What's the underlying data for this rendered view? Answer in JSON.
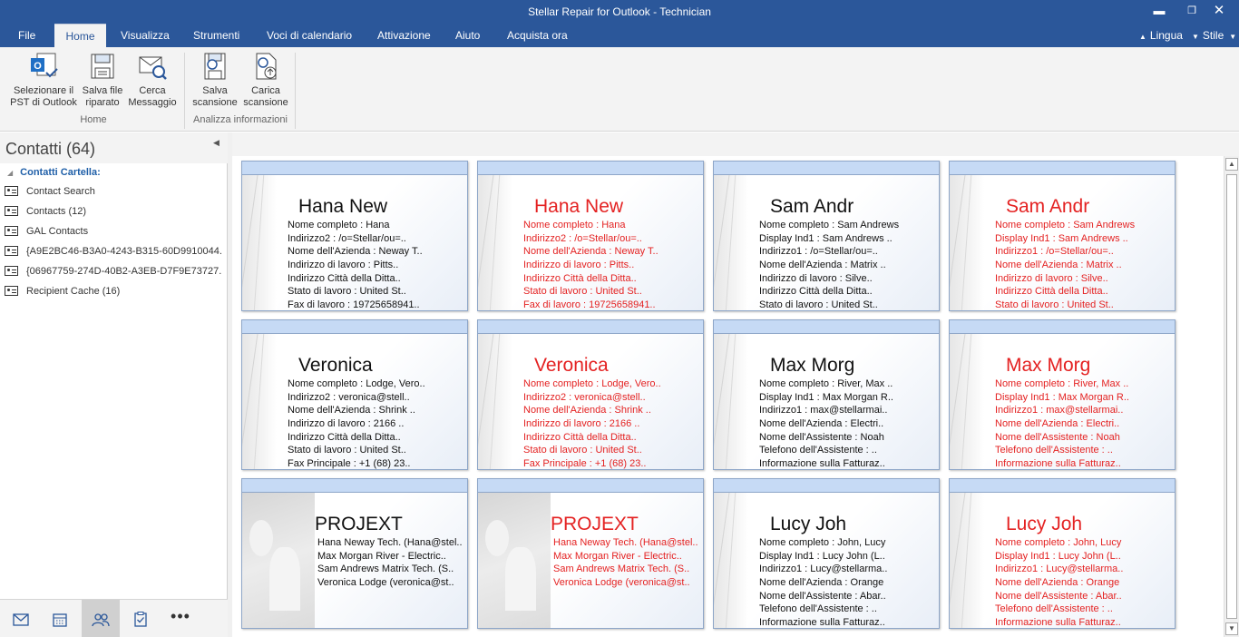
{
  "window": {
    "title": "Stellar Repair for Outlook - Technician",
    "controls": {
      "minimize": "▬",
      "maximize": "❐",
      "close": "✕"
    }
  },
  "menu": {
    "items": [
      "File",
      "Home",
      "Visualizza",
      "Strumenti",
      "Voci di calendario",
      "Attivazione",
      "Aiuto",
      "Acquista ora"
    ],
    "active": "Home",
    "lingua": "Lingua",
    "stile": "Stile"
  },
  "ribbon": {
    "buttons": [
      {
        "label1": "Selezionare il",
        "label2": "PST di Outlook",
        "icon": "outlook-pst-icon"
      },
      {
        "label1": "Salva file",
        "label2": "riparato",
        "icon": "save-icon"
      },
      {
        "label1": "Cerca",
        "label2": "Messaggio",
        "icon": "search-message-icon"
      },
      {
        "label1": "Salva",
        "label2": "scansione",
        "icon": "save-scan-icon"
      },
      {
        "label1": "Carica",
        "label2": "scansione",
        "icon": "load-scan-icon"
      }
    ],
    "groups": [
      "Home",
      "Analizza informazioni"
    ]
  },
  "leftpane": {
    "title": "Contatti (64)",
    "tree_root": "Contatti Cartella:",
    "items": [
      "Contact Search",
      "Contacts (12)",
      "GAL Contacts",
      "{A9E2BC46-B3A0-4243-B315-60D9910044...",
      "{06967759-274D-40B2-A3EB-D7F9E73727...",
      "Recipient Cache (16)"
    ]
  },
  "bottomnav": [
    "mail-icon",
    "calendar-icon",
    "contacts-icon",
    "tasks-icon",
    "more-icon"
  ],
  "cards": [
    {
      "name": "Hana New",
      "red": false,
      "group": false,
      "lines": [
        "Nome completo : Hana",
        "Indirizzo2 : /o=Stellar/ou=..",
        "Nome dell'Azienda : Neway T..",
        "Indirizzo di lavoro : Pitts..",
        "Indirizzo Città della Ditta..",
        "Stato di lavoro : United St..",
        "Fax di lavoro : 19725658941.."
      ]
    },
    {
      "name": "Hana New",
      "red": true,
      "group": false,
      "lines": [
        "Nome completo : Hana",
        "Indirizzo2 : /o=Stellar/ou=..",
        "Nome dell'Azienda : Neway T..",
        "Indirizzo di lavoro : Pitts..",
        "Indirizzo Città della Ditta..",
        "Stato di lavoro : United St..",
        "Fax di lavoro : 19725658941.."
      ]
    },
    {
      "name": "Sam Andr",
      "red": false,
      "group": false,
      "lines": [
        "Nome completo : Sam Andrews",
        "Display Ind1 : Sam Andrews ..",
        "Indirizzo1 : /o=Stellar/ou=..",
        "Nome dell'Azienda : Matrix ..",
        "Indirizzo di lavoro : Silve..",
        "Indirizzo Città della Ditta..",
        "Stato di lavoro : United St.."
      ]
    },
    {
      "name": "Sam Andr",
      "red": true,
      "group": false,
      "lines": [
        "Nome completo : Sam Andrews",
        "Display Ind1 : Sam Andrews ..",
        "Indirizzo1 : /o=Stellar/ou=..",
        "Nome dell'Azienda : Matrix ..",
        "Indirizzo di lavoro : Silve..",
        "Indirizzo Città della Ditta..",
        "Stato di lavoro : United St.."
      ]
    },
    {
      "name": "Veronica",
      "red": false,
      "group": false,
      "lines": [
        "Nome completo : Lodge, Vero..",
        "Indirizzo2 : veronica@stell..",
        "Nome dell'Azienda : Shrink ..",
        "Indirizzo di lavoro : 2166 ..",
        "Indirizzo Città della Ditta..",
        "Stato di lavoro : United St..",
        "Fax Principale : +1 (68) 23.."
      ]
    },
    {
      "name": "Veronica",
      "red": true,
      "group": false,
      "lines": [
        "Nome completo : Lodge, Vero..",
        "Indirizzo2 : veronica@stell..",
        "Nome dell'Azienda : Shrink ..",
        "Indirizzo di lavoro : 2166 ..",
        "Indirizzo Città della Ditta..",
        "Stato di lavoro : United St..",
        "Fax Principale : +1 (68) 23.."
      ]
    },
    {
      "name": "Max Morg",
      "red": false,
      "group": false,
      "lines": [
        "Nome completo : River, Max ..",
        "Display Ind1 : Max Morgan R..",
        "Indirizzo1 : max@stellarmai..",
        "Nome dell'Azienda : Electri..",
        "Nome dell'Assistente : Noah",
        "Telefono dell'Assistente : ..",
        "Informazione sulla Fatturaz.."
      ]
    },
    {
      "name": "Max Morg",
      "red": true,
      "group": false,
      "lines": [
        "Nome completo : River, Max ..",
        "Display Ind1 : Max Morgan R..",
        "Indirizzo1 : max@stellarmai..",
        "Nome dell'Azienda : Electri..",
        "Nome dell'Assistente : Noah",
        "Telefono dell'Assistente : ..",
        "Informazione sulla Fatturaz.."
      ]
    },
    {
      "name": "PROJEXT",
      "red": false,
      "group": true,
      "lines": [
        "Hana Neway Tech. (Hana@stel..",
        "Max Morgan River - Electric..",
        "Sam Andrews Matrix Tech. (S..",
        "Veronica Lodge (veronica@st.."
      ]
    },
    {
      "name": "PROJEXT",
      "red": true,
      "group": true,
      "lines": [
        "Hana Neway Tech. (Hana@stel..",
        "Max Morgan River - Electric..",
        "Sam Andrews Matrix Tech. (S..",
        "Veronica Lodge (veronica@st.."
      ]
    },
    {
      "name": "Lucy Joh",
      "red": false,
      "group": false,
      "lines": [
        "Nome completo : John, Lucy",
        "Display Ind1 : Lucy John (L..",
        "Indirizzo1 : Lucy@stellarma..",
        "Nome dell'Azienda : Orange",
        "Nome dell'Assistente : Abar..",
        "Telefono dell'Assistente : ..",
        "Informazione sulla Fatturaz.."
      ]
    },
    {
      "name": "Lucy Joh",
      "red": true,
      "group": false,
      "lines": [
        "Nome completo : John, Lucy",
        "Display Ind1 : Lucy John (L..",
        "Indirizzo1 : Lucy@stellarma..",
        "Nome dell'Azienda : Orange",
        "Nome dell'Assistente : Abar..",
        "Telefono dell'Assistente : ..",
        "Informazione sulla Fatturaz.."
      ]
    }
  ],
  "colors": {
    "titlebar": "#2b579a",
    "accent": "#1f5fa8",
    "deleted_text": "#e42222",
    "card_header": "#c6daf5"
  }
}
